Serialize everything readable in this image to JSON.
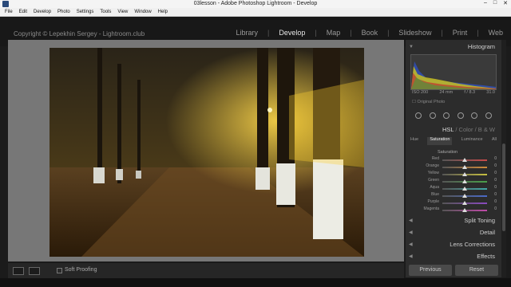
{
  "window": {
    "title": "03lesson - Adobe Photoshop Lightroom - Develop",
    "controls": [
      "–",
      "□",
      "✕"
    ]
  },
  "menu": [
    "File",
    "Edit",
    "Develop",
    "Photo",
    "Settings",
    "Tools",
    "View",
    "Window",
    "Help"
  ],
  "identity_plate": "Copyright © Lepekhin Sergey - Lightroom.club",
  "modules": [
    "Library",
    "Develop",
    "Map",
    "Book",
    "Slideshow",
    "Print",
    "Web"
  ],
  "active_module": "Develop",
  "histogram": {
    "title": "Histogram",
    "exif": {
      "iso": "ISO 200",
      "focal": "24 mm",
      "aperture": "f / 8.3",
      "shutter": "31.0"
    },
    "original_photo_label": "Original Photo"
  },
  "hsl_panel": {
    "hsl_label": "HSL",
    "color_label": "Color",
    "bw_label": "B & W",
    "tabs": [
      "Hue",
      "Saturation",
      "Luminance",
      "All"
    ],
    "active_tab": "Saturation",
    "group_label": "Saturation",
    "sliders": [
      {
        "name": "Red",
        "value": "0",
        "color": "#c84a4a"
      },
      {
        "name": "Orange",
        "value": "0",
        "color": "#d08a3a"
      },
      {
        "name": "Yellow",
        "value": "0",
        "color": "#c8c040"
      },
      {
        "name": "Green",
        "value": "0",
        "color": "#4aa04a"
      },
      {
        "name": "Aqua",
        "value": "0",
        "color": "#40a8a8"
      },
      {
        "name": "Blue",
        "value": "0",
        "color": "#4a6ac8"
      },
      {
        "name": "Purple",
        "value": "0",
        "color": "#8a4ac0"
      },
      {
        "name": "Magenta",
        "value": "0",
        "color": "#c04aa8"
      }
    ]
  },
  "collapsed_panels": [
    "Split Toning",
    "Detail",
    "Lens Corrections",
    "Effects"
  ],
  "buttons": {
    "previous": "Previous",
    "reset": "Reset"
  },
  "toolbar": {
    "soft_proofing": "Soft Proofing"
  }
}
